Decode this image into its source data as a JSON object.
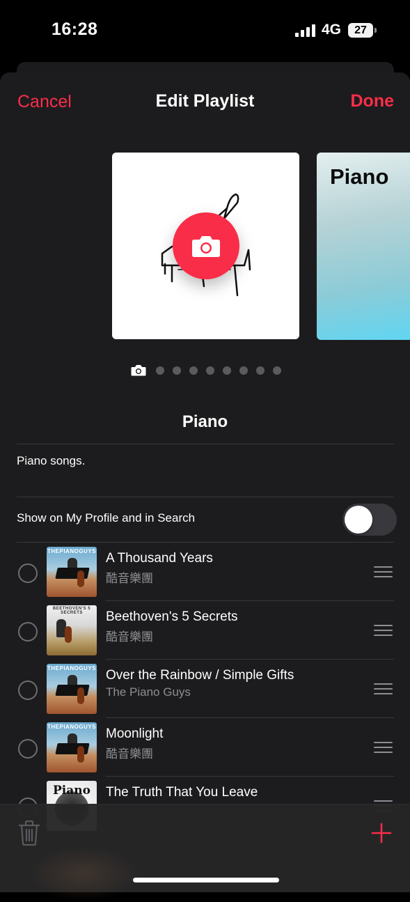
{
  "status_bar": {
    "time": "16:28",
    "network": "4G",
    "battery": "27"
  },
  "nav": {
    "cancel": "Cancel",
    "title": "Edit Playlist",
    "done": "Done"
  },
  "artwork": {
    "icon": "piano-drawing",
    "camera_icon": "camera-icon",
    "next_title": "Piano",
    "page_count": 8
  },
  "playlist": {
    "name": "Piano",
    "description": "Piano songs."
  },
  "profile_toggle": {
    "label": "Show on My Profile and in Search",
    "on": false
  },
  "songs": [
    {
      "title": "A Thousand Years",
      "artist": "酷音樂團",
      "art_banner": "THEPIANOGUYS"
    },
    {
      "title": "Beethoven's 5 Secrets",
      "artist": "酷音樂團",
      "art_banner": "BEETHOVEN'S 5 SECRETS"
    },
    {
      "title": "Over the Rainbow / Simple Gifts",
      "artist": "The Piano Guys",
      "art_banner": "THEPIANOGUYS"
    },
    {
      "title": "Moonlight",
      "artist": "酷音樂團",
      "art_banner": "THEPIANOGUYS"
    },
    {
      "title": "The Truth That You Leave",
      "artist": "",
      "art_banner": "Piano"
    }
  ],
  "colors": {
    "accent": "#fa2d48",
    "sheet_bg": "#1c1c1e",
    "secondary_text": "#8e8e93"
  },
  "toolbar": {
    "delete_icon": "trash-icon",
    "add_icon": "plus-icon"
  }
}
